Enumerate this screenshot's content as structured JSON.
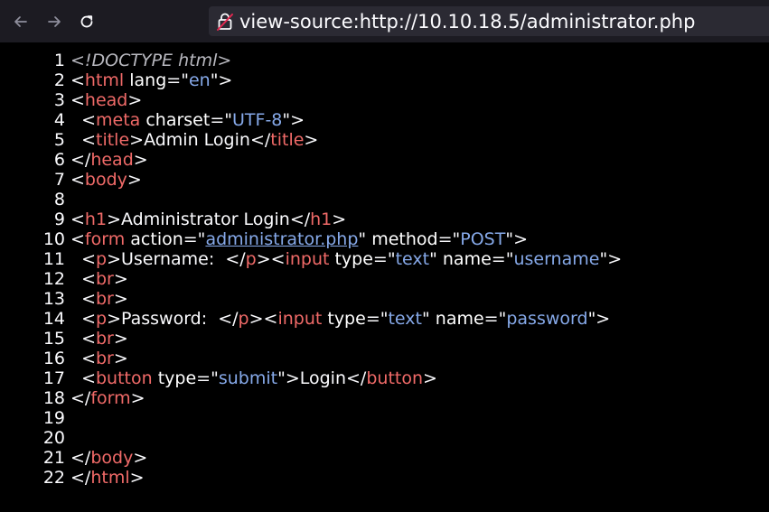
{
  "browser": {
    "url": "view-source:http://10.10.18.5/administrator.php"
  },
  "source": {
    "lines": [
      {
        "n": "1",
        "tokens": [
          {
            "t": "doctype",
            "v": "<!DOCTYPE html>"
          }
        ]
      },
      {
        "n": "2",
        "tokens": [
          {
            "t": "punct",
            "v": "<"
          },
          {
            "t": "tag",
            "v": "html"
          },
          {
            "t": "attr",
            "v": " lang"
          },
          {
            "t": "punct",
            "v": "=\""
          },
          {
            "t": "val",
            "v": "en"
          },
          {
            "t": "punct",
            "v": "\">"
          }
        ]
      },
      {
        "n": "3",
        "tokens": [
          {
            "t": "punct",
            "v": "<"
          },
          {
            "t": "tag",
            "v": "head"
          },
          {
            "t": "punct",
            "v": ">"
          }
        ]
      },
      {
        "n": "4",
        "tokens": [
          {
            "t": "punct",
            "v": "  <"
          },
          {
            "t": "tag",
            "v": "meta"
          },
          {
            "t": "attr",
            "v": " charset"
          },
          {
            "t": "punct",
            "v": "=\""
          },
          {
            "t": "val",
            "v": "UTF-8"
          },
          {
            "t": "punct",
            "v": "\">"
          }
        ]
      },
      {
        "n": "5",
        "tokens": [
          {
            "t": "punct",
            "v": "  <"
          },
          {
            "t": "tag",
            "v": "title"
          },
          {
            "t": "punct",
            "v": ">"
          },
          {
            "t": "text",
            "v": "Admin Login"
          },
          {
            "t": "punct",
            "v": "</"
          },
          {
            "t": "tag",
            "v": "title"
          },
          {
            "t": "punct",
            "v": ">"
          }
        ]
      },
      {
        "n": "6",
        "tokens": [
          {
            "t": "punct",
            "v": "</"
          },
          {
            "t": "tag",
            "v": "head"
          },
          {
            "t": "punct",
            "v": ">"
          }
        ]
      },
      {
        "n": "7",
        "tokens": [
          {
            "t": "punct",
            "v": "<"
          },
          {
            "t": "tag",
            "v": "body"
          },
          {
            "t": "punct",
            "v": ">"
          }
        ]
      },
      {
        "n": "8",
        "tokens": []
      },
      {
        "n": "9",
        "tokens": [
          {
            "t": "punct",
            "v": "<"
          },
          {
            "t": "tag",
            "v": "h1"
          },
          {
            "t": "punct",
            "v": ">"
          },
          {
            "t": "text",
            "v": "Administrator Login"
          },
          {
            "t": "punct",
            "v": "</"
          },
          {
            "t": "tag",
            "v": "h1"
          },
          {
            "t": "punct",
            "v": ">"
          }
        ]
      },
      {
        "n": "10",
        "tokens": [
          {
            "t": "punct",
            "v": "<"
          },
          {
            "t": "tag",
            "v": "form"
          },
          {
            "t": "attr",
            "v": " action"
          },
          {
            "t": "punct",
            "v": "=\""
          },
          {
            "t": "link",
            "v": "administrator.php"
          },
          {
            "t": "punct",
            "v": "\""
          },
          {
            "t": "attr",
            "v": " method"
          },
          {
            "t": "punct",
            "v": "=\""
          },
          {
            "t": "val",
            "v": "POST"
          },
          {
            "t": "punct",
            "v": "\">"
          }
        ]
      },
      {
        "n": "11",
        "tokens": [
          {
            "t": "punct",
            "v": "  <"
          },
          {
            "t": "tag",
            "v": "p"
          },
          {
            "t": "punct",
            "v": ">"
          },
          {
            "t": "text",
            "v": "Username:  "
          },
          {
            "t": "punct",
            "v": "</"
          },
          {
            "t": "tag",
            "v": "p"
          },
          {
            "t": "punct",
            "v": "><"
          },
          {
            "t": "tag",
            "v": "input"
          },
          {
            "t": "attr",
            "v": " type"
          },
          {
            "t": "punct",
            "v": "=\""
          },
          {
            "t": "val",
            "v": "text"
          },
          {
            "t": "punct",
            "v": "\""
          },
          {
            "t": "attr",
            "v": " name"
          },
          {
            "t": "punct",
            "v": "=\""
          },
          {
            "t": "val",
            "v": "username"
          },
          {
            "t": "punct",
            "v": "\">"
          }
        ]
      },
      {
        "n": "12",
        "tokens": [
          {
            "t": "punct",
            "v": "  <"
          },
          {
            "t": "tag",
            "v": "br"
          },
          {
            "t": "punct",
            "v": ">"
          }
        ]
      },
      {
        "n": "13",
        "tokens": [
          {
            "t": "punct",
            "v": "  <"
          },
          {
            "t": "tag",
            "v": "br"
          },
          {
            "t": "punct",
            "v": ">"
          }
        ]
      },
      {
        "n": "14",
        "tokens": [
          {
            "t": "punct",
            "v": "  <"
          },
          {
            "t": "tag",
            "v": "p"
          },
          {
            "t": "punct",
            "v": ">"
          },
          {
            "t": "text",
            "v": "Password:  "
          },
          {
            "t": "punct",
            "v": "</"
          },
          {
            "t": "tag",
            "v": "p"
          },
          {
            "t": "punct",
            "v": "><"
          },
          {
            "t": "tag",
            "v": "input"
          },
          {
            "t": "attr",
            "v": " type"
          },
          {
            "t": "punct",
            "v": "=\""
          },
          {
            "t": "val",
            "v": "text"
          },
          {
            "t": "punct",
            "v": "\""
          },
          {
            "t": "attr",
            "v": " name"
          },
          {
            "t": "punct",
            "v": "=\""
          },
          {
            "t": "val",
            "v": "password"
          },
          {
            "t": "punct",
            "v": "\">"
          }
        ]
      },
      {
        "n": "15",
        "tokens": [
          {
            "t": "punct",
            "v": "  <"
          },
          {
            "t": "tag",
            "v": "br"
          },
          {
            "t": "punct",
            "v": ">"
          }
        ]
      },
      {
        "n": "16",
        "tokens": [
          {
            "t": "punct",
            "v": "  <"
          },
          {
            "t": "tag",
            "v": "br"
          },
          {
            "t": "punct",
            "v": ">"
          }
        ]
      },
      {
        "n": "17",
        "tokens": [
          {
            "t": "punct",
            "v": "  <"
          },
          {
            "t": "tag",
            "v": "button"
          },
          {
            "t": "attr",
            "v": " type"
          },
          {
            "t": "punct",
            "v": "=\""
          },
          {
            "t": "val",
            "v": "submit"
          },
          {
            "t": "punct",
            "v": "\">"
          },
          {
            "t": "text",
            "v": "Login"
          },
          {
            "t": "punct",
            "v": "</"
          },
          {
            "t": "tag",
            "v": "button"
          },
          {
            "t": "punct",
            "v": ">"
          }
        ]
      },
      {
        "n": "18",
        "tokens": [
          {
            "t": "punct",
            "v": "</"
          },
          {
            "t": "tag",
            "v": "form"
          },
          {
            "t": "punct",
            "v": ">"
          }
        ]
      },
      {
        "n": "19",
        "tokens": []
      },
      {
        "n": "20",
        "tokens": []
      },
      {
        "n": "21",
        "tokens": [
          {
            "t": "punct",
            "v": "</"
          },
          {
            "t": "tag",
            "v": "body"
          },
          {
            "t": "punct",
            "v": ">"
          }
        ]
      },
      {
        "n": "22",
        "tokens": [
          {
            "t": "punct",
            "v": "</"
          },
          {
            "t": "tag",
            "v": "html"
          },
          {
            "t": "punct",
            "v": ">"
          }
        ]
      }
    ]
  },
  "colors": {
    "toolbar_bg": "#1c1b22",
    "urlbar_bg": "#2b2a33",
    "tag": "#f06a68",
    "value": "#86a9e9",
    "text": "#fbfbfe"
  },
  "icons": {
    "back": "arrow-left-icon",
    "forward": "arrow-right-icon",
    "reload": "reload-icon",
    "insecure": "insecure-lock-icon"
  }
}
